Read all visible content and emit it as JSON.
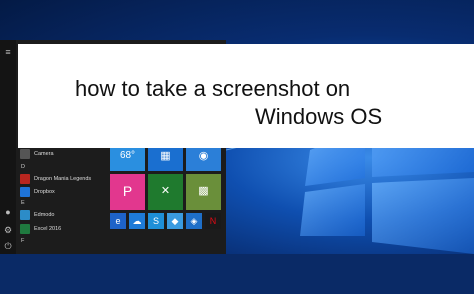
{
  "banner": {
    "line1": "how to take a screenshot on",
    "line2": "Windows OS"
  },
  "start_menu": {
    "apps": [
      {
        "label": "Camera",
        "icon": "camera-icon",
        "color": "#555555"
      },
      {
        "letter": "D"
      },
      {
        "label": "Dragon Mania Legends",
        "icon": "dragon-icon",
        "color": "#b8261f"
      },
      {
        "label": "Dropbox",
        "icon": "dropbox-icon",
        "color": "#1e73d8"
      },
      {
        "letter": "E"
      },
      {
        "label": "Edmodo",
        "icon": "edmodo-icon",
        "color": "#2c8cc8"
      },
      {
        "label": "Excel 2016",
        "icon": "excel-icon",
        "color": "#1f7a3f"
      },
      {
        "letter": "F"
      }
    ],
    "tiles": [
      {
        "name": "weather-tile",
        "label": "",
        "glyph": "68°",
        "color": "#2a8fe0"
      },
      {
        "name": "store-tile",
        "label": "",
        "glyph": "▦",
        "color": "#1a6fd0"
      },
      {
        "name": "skype-tile",
        "label": "",
        "glyph": "◉",
        "color": "#2b7fd8"
      },
      {
        "name": "picsart-tile",
        "label": "",
        "glyph": "P",
        "color": "#e2378e"
      },
      {
        "name": "xbox-tile",
        "label": "",
        "glyph": "✕",
        "color": "#1f7a2e"
      },
      {
        "name": "minecraft-tile",
        "label": "",
        "glyph": "▩",
        "color": "#6a8f3a"
      },
      {
        "name": "edge-tile",
        "label": "",
        "glyph": "e",
        "color": "#1e63c8"
      },
      {
        "name": "onedrive-tile",
        "label": "",
        "glyph": "☁",
        "color": "#1e7bd8"
      },
      {
        "name": "skype-app-tile",
        "label": "",
        "glyph": "S",
        "color": "#1e8fd8"
      },
      {
        "name": "twitter-tile",
        "label": "",
        "glyph": "◆",
        "color": "#3a9be0"
      },
      {
        "name": "shield-tile",
        "label": "",
        "glyph": "◈",
        "color": "#1e6fc8"
      },
      {
        "name": "netflix-tile",
        "label": "",
        "glyph": "N",
        "color": "#1a1a1a"
      }
    ]
  }
}
